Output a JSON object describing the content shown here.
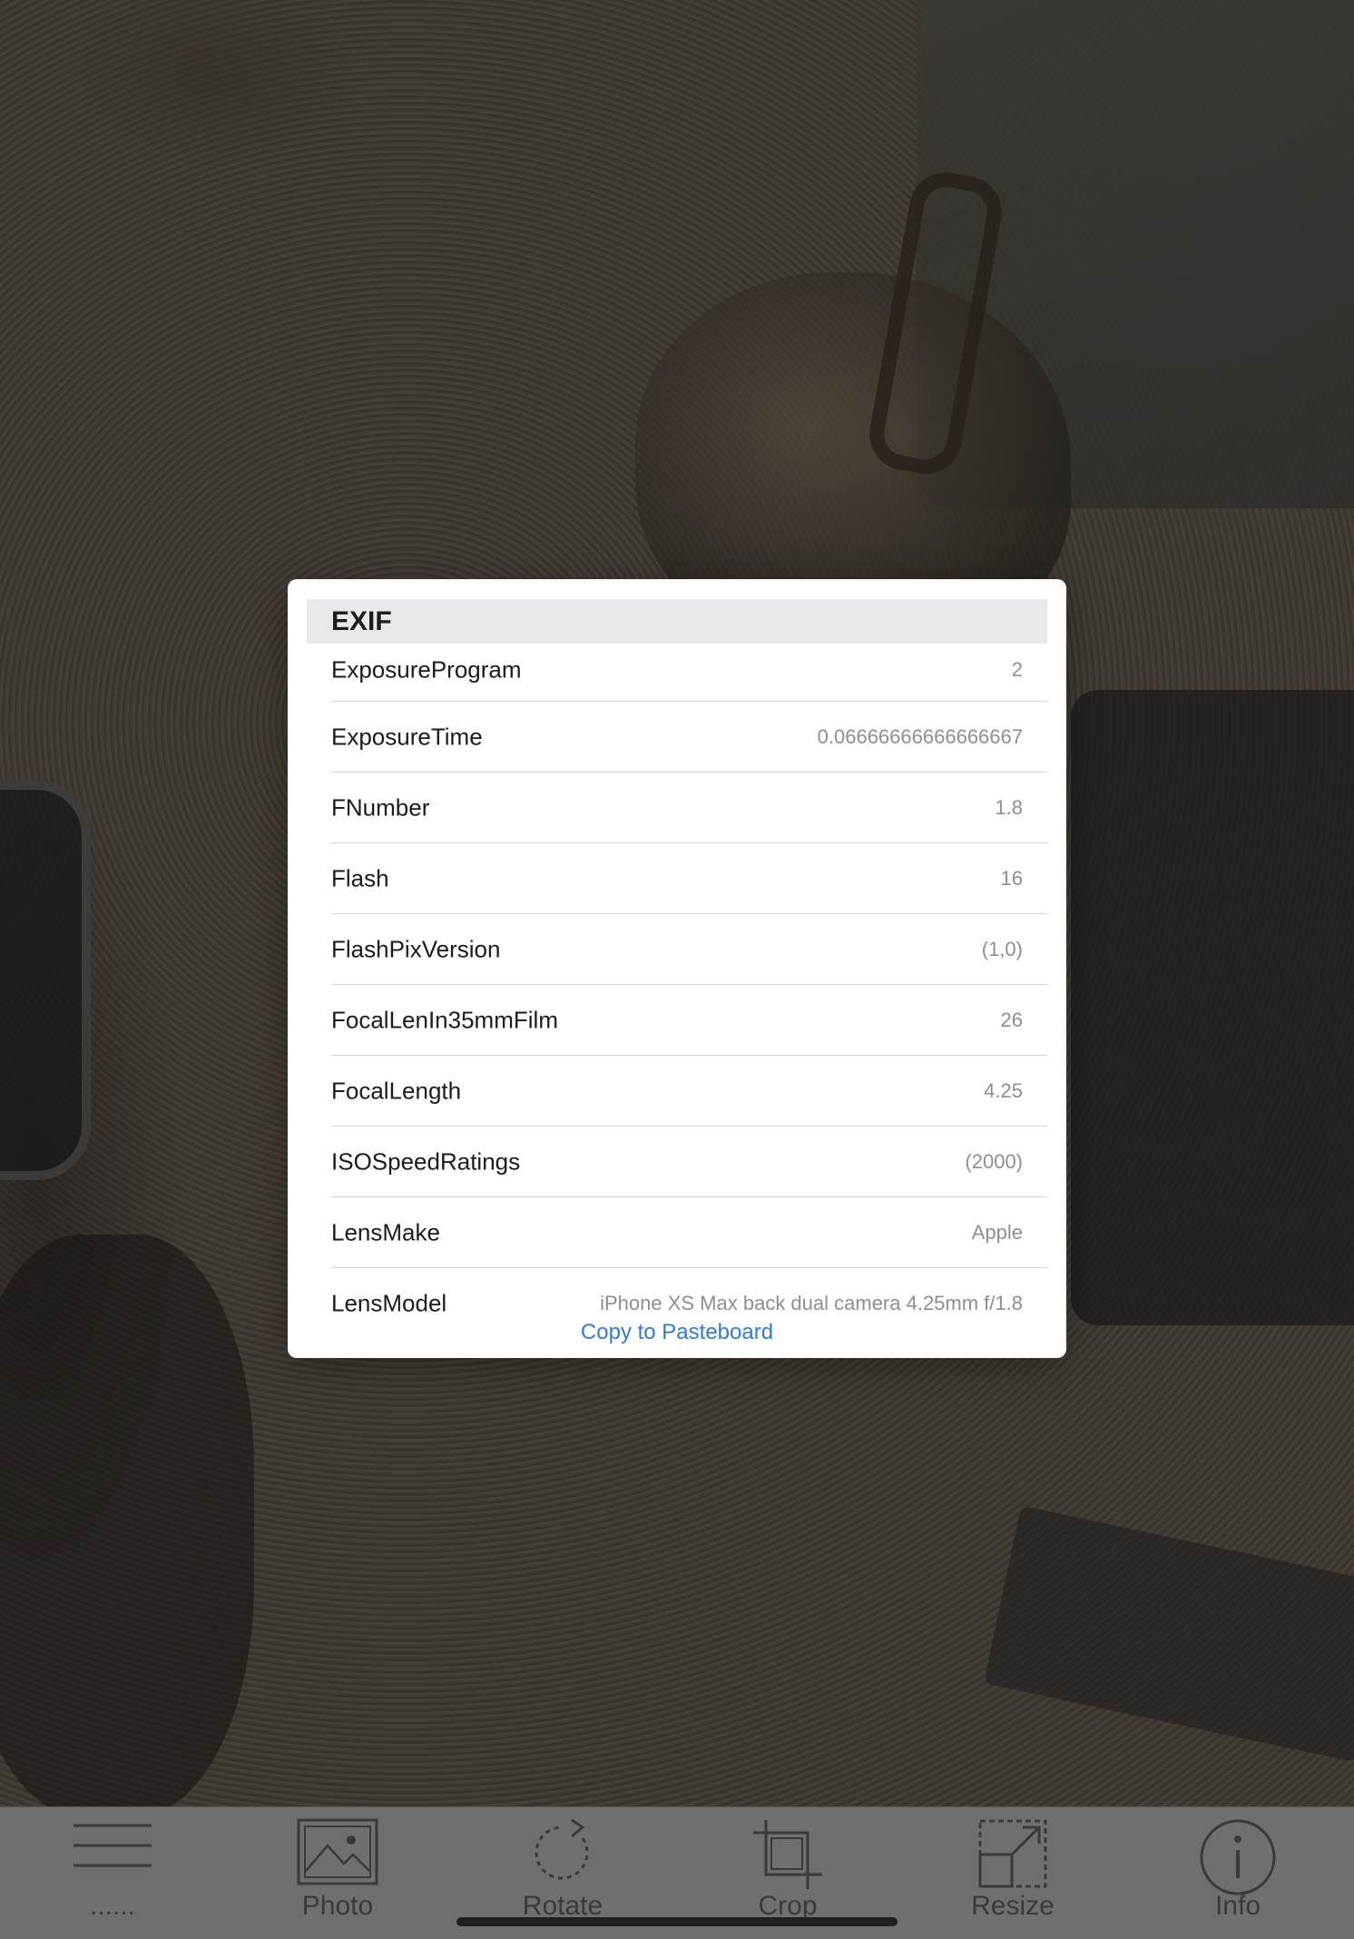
{
  "exif_popover": {
    "section_title": "EXIF",
    "rows": [
      {
        "key": "ExposureProgram",
        "value": "2"
      },
      {
        "key": "ExposureTime",
        "value": "0.06666666666666667"
      },
      {
        "key": "FNumber",
        "value": "1.8"
      },
      {
        "key": "Flash",
        "value": "16"
      },
      {
        "key": "FlashPixVersion",
        "value": "(1,0)"
      },
      {
        "key": "FocalLenIn35mmFilm",
        "value": "26"
      },
      {
        "key": "FocalLength",
        "value": "4.25"
      },
      {
        "key": "ISOSpeedRatings",
        "value": "(2000)"
      },
      {
        "key": "LensMake",
        "value": "Apple"
      },
      {
        "key": "LensModel",
        "value": "iPhone XS Max back dual camera 4.25mm f/1.8"
      }
    ],
    "copy_label": "Copy to Pasteboard",
    "accent_color": "#2f7bd6"
  },
  "toolbar": {
    "items": [
      {
        "label": "......",
        "icon": "menu-icon"
      },
      {
        "label": "Photo",
        "icon": "photo-icon"
      },
      {
        "label": "Rotate",
        "icon": "rotate-icon"
      },
      {
        "label": "Crop",
        "icon": "crop-icon"
      },
      {
        "label": "Resize",
        "icon": "resize-icon"
      },
      {
        "label": "Info",
        "icon": "info-icon"
      }
    ]
  }
}
